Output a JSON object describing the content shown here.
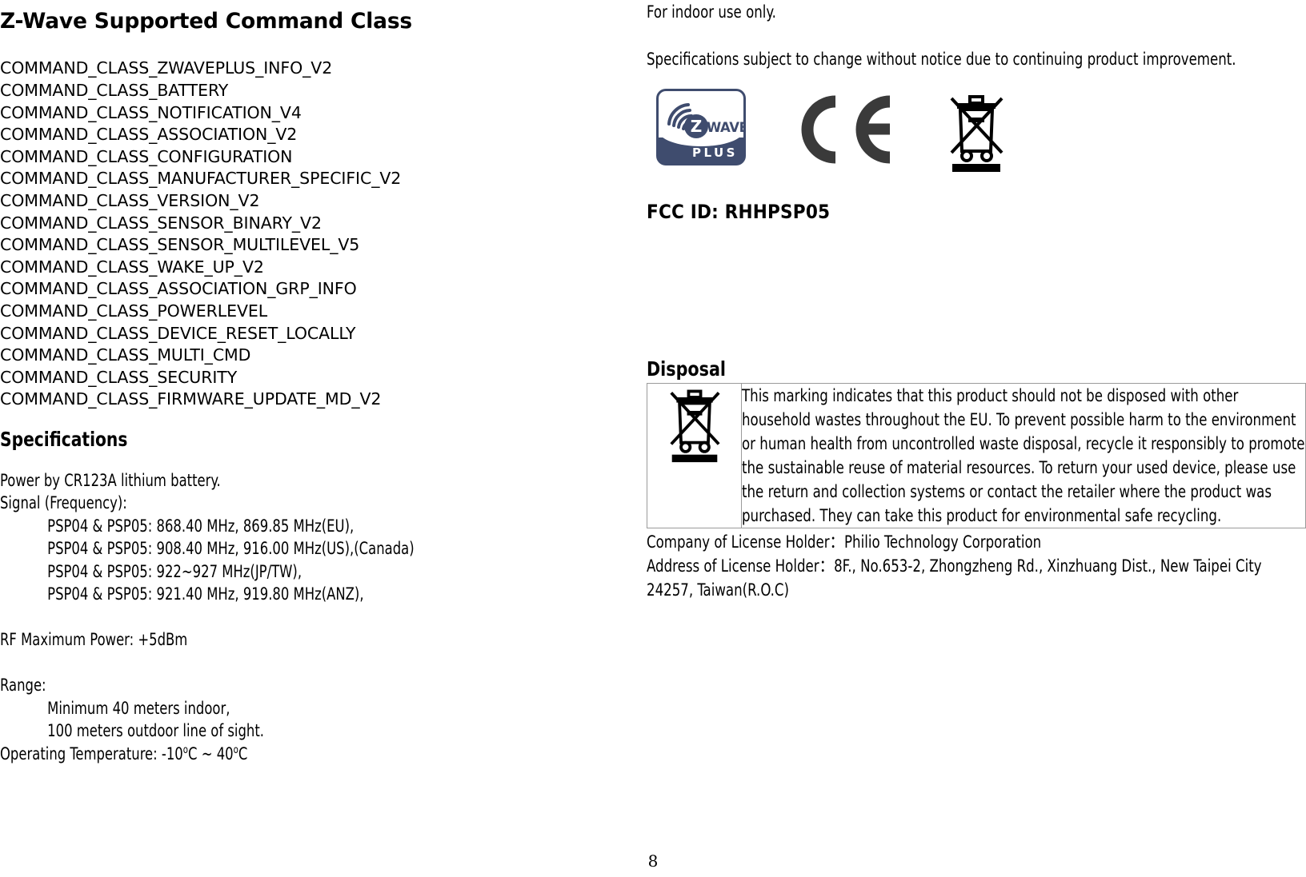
{
  "left_column": {
    "heading": "Z-Wave Supported Command Class",
    "command_classes": [
      "COMMAND_CLASS_ZWAVEPLUS_INFO_V2",
      "COMMAND_CLASS_BATTERY",
      "COMMAND_CLASS_NOTIFICATION_V4",
      "COMMAND_CLASS_ASSOCIATION_V2",
      "COMMAND_CLASS_CONFIGURATION",
      "COMMAND_CLASS_MANUFACTURER_SPECIFIC_V2",
      "COMMAND_CLASS_VERSION_V2",
      "COMMAND_CLASS_SENSOR_BINARY_V2",
      "COMMAND_CLASS_SENSOR_MULTILEVEL_V5",
      "COMMAND_CLASS_WAKE_UP_V2",
      "COMMAND_CLASS_ASSOCIATION_GRP_INFO",
      "COMMAND_CLASS_POWERLEVEL",
      "COMMAND_CLASS_DEVICE_RESET_LOCALLY",
      "COMMAND_CLASS_MULTI_CMD",
      "COMMAND_CLASS_SECURITY",
      "COMMAND_CLASS_FIRMWARE_UPDATE_MD_V2"
    ],
    "specifications": {
      "heading": "Specifications",
      "power": "Power by CR123A lithium battery.",
      "signal_label": "Signal (Frequency):",
      "signal_lines": [
        "PSP04 & PSP05: 868.40 MHz, 869.85 MHz(EU),",
        "PSP04 & PSP05: 908.40 MHz, 916.00 MHz(US),(Canada)",
        "PSP04 & PSP05: 922~927 MHz(JP/TW),",
        "PSP04 & PSP05: 921.40 MHz, 919.80 MHz(ANZ),"
      ],
      "rf_power": "RF Maximum Power: +5dBm",
      "range_label": "Range:",
      "range_lines": [
        "Minimum 40 meters indoor,",
        "100 meters outdoor line of sight."
      ],
      "operating_temperature_prefix": "Operating Temperature: -10",
      "operating_temperature_mid": "C ~ 40",
      "operating_temperature_suffix": "C",
      "degree_glyph": "o"
    }
  },
  "right_column": {
    "indoor_note": "For indoor use only.",
    "disclaimer": "Specifications subject to change without notice due to continuing product improvement.",
    "logos": [
      {
        "name": "zwave-plus-logo",
        "brand_text": "WAVE",
        "letter": "Z",
        "sub_text": "PLUS",
        "color": "#3f4c6e"
      },
      {
        "name": "ce-mark-logo",
        "label": "CE",
        "color": "#3a3a3a"
      },
      {
        "name": "weee-bin-logo",
        "label": "Crossed-out wheeled bin",
        "color": "#000000"
      }
    ],
    "fcc_id": "FCC ID: RHHPSP05",
    "disposal": {
      "heading": "Disposal",
      "icon_name": "weee-bin-icon",
      "text": "This marking indicates that this product should not be disposed with other household wastes throughout the EU. To prevent possible harm to the environment or human health from uncontrolled waste disposal, recycle it responsibly to promote the sustainable reuse of material resources. To return your used device, please use the return and collection systems or contact the retailer where the product was purchased. They can take this product for environmental safe recycling."
    },
    "license_holder": {
      "company_line": "Company of License Holder：Philio Technology Corporation",
      "address_line": "Address of License Holder：8F., No.653-2, Zhongzheng Rd., Xinzhuang Dist., New Taipei City 24257, Taiwan(R.O.C)"
    }
  },
  "footer": {
    "page_number": "8"
  }
}
